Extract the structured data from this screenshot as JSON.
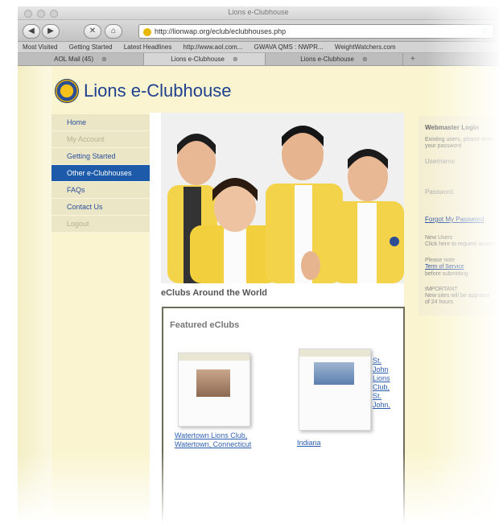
{
  "window": {
    "title": "Lions e-Clubhouse"
  },
  "toolbar": {
    "back": "◀",
    "forward": "▶",
    "reload": "✕",
    "home": "⌂",
    "url": "http://lionwap.org/eclub/eclubhouses.php",
    "star": "☆"
  },
  "bookmarks": [
    "Most Visited",
    "Getting Started",
    "Latest Headlines",
    "http://www.aol.com...",
    "GWAVA QMS : NWPR...",
    "WeightWatchers.com"
  ],
  "tabs": [
    {
      "label": "AOL Mail (45)",
      "close": "⊗"
    },
    {
      "label": "Lions e-Clubhouse",
      "close": "⊗"
    },
    {
      "label": "Lions e-Clubhouse",
      "close": "⊗"
    }
  ],
  "new_tab": "+",
  "site": {
    "logo_text": "Lions e-Clubhouse"
  },
  "nav": [
    {
      "label": "Home",
      "state": "normal"
    },
    {
      "label": "My Account",
      "state": "disabled"
    },
    {
      "label": "Getting Started",
      "state": "normal"
    },
    {
      "label": "Other e-Clubhouses",
      "state": "active"
    },
    {
      "label": "FAQs",
      "state": "normal"
    },
    {
      "label": "Contact Us",
      "state": "normal"
    },
    {
      "label": "Logout",
      "state": "disabled"
    }
  ],
  "main": {
    "heading": "eClubs Around the World",
    "featured_title": "Featured eClubs",
    "clubs": [
      {
        "name": "Watertown Lions Club, Watertown, Connecticut"
      },
      {
        "name": "St. John Lions Club, St. John,",
        "location": "Indiana"
      }
    ]
  },
  "sidebar": {
    "title": "Webmaster Login",
    "existing_text": "Existing users, please enter your password",
    "username_label": "Username",
    "password_label": "Password",
    "forgot_link": "Forgot My Password",
    "new_users": "New Users",
    "new_users_text": "Click here to request access",
    "note": "Please note",
    "terms_link": "Term of Service",
    "note_text": "before submitting",
    "important": "IMPORTANT",
    "important_text": "New sites will be approval of 24 hours"
  },
  "colors": {
    "brand_blue": "#1f3f8f",
    "nav_active": "#1d5baa",
    "page_bg": "#faf5d0"
  }
}
